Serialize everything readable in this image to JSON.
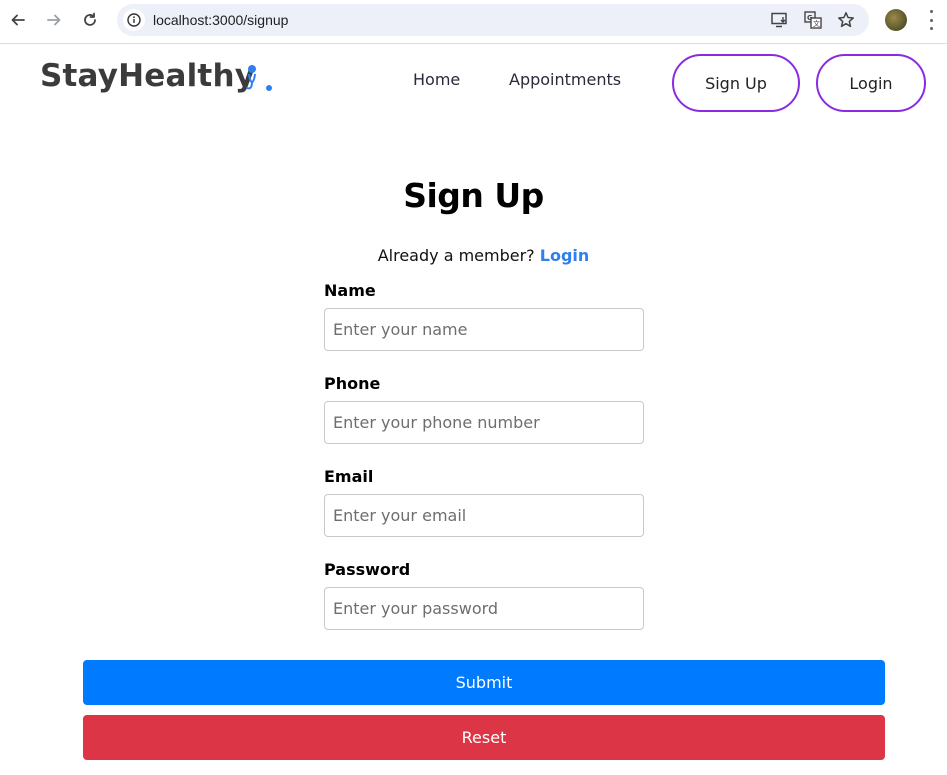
{
  "browser": {
    "url": "localhost:3000/signup"
  },
  "navbar": {
    "brand": "StayHealthy",
    "links": [
      "Home",
      "Appointments"
    ],
    "signup_label": "Sign Up",
    "login_label": "Login"
  },
  "form": {
    "title": "Sign Up",
    "member_text": "Already a member?",
    "member_link": "Login",
    "fields": [
      {
        "label": "Name",
        "placeholder": "Enter your name",
        "value": ""
      },
      {
        "label": "Phone",
        "placeholder": "Enter your phone number",
        "value": ""
      },
      {
        "label": "Email",
        "placeholder": "Enter your email",
        "value": ""
      },
      {
        "label": "Password",
        "placeholder": "Enter your password",
        "value": ""
      }
    ],
    "submit_label": "Submit",
    "reset_label": "Reset"
  },
  "colors": {
    "accent_border": "#8a2be2",
    "submit_bg": "#007bff",
    "reset_bg": "#dc3545",
    "link": "#2f80ed"
  },
  "icons": [
    "back-arrow-icon",
    "forward-arrow-icon",
    "reload-icon",
    "info-icon",
    "install-app-icon",
    "translate-icon",
    "star-icon",
    "profile-avatar",
    "menu-dots-icon",
    "brand-logo-icon"
  ]
}
